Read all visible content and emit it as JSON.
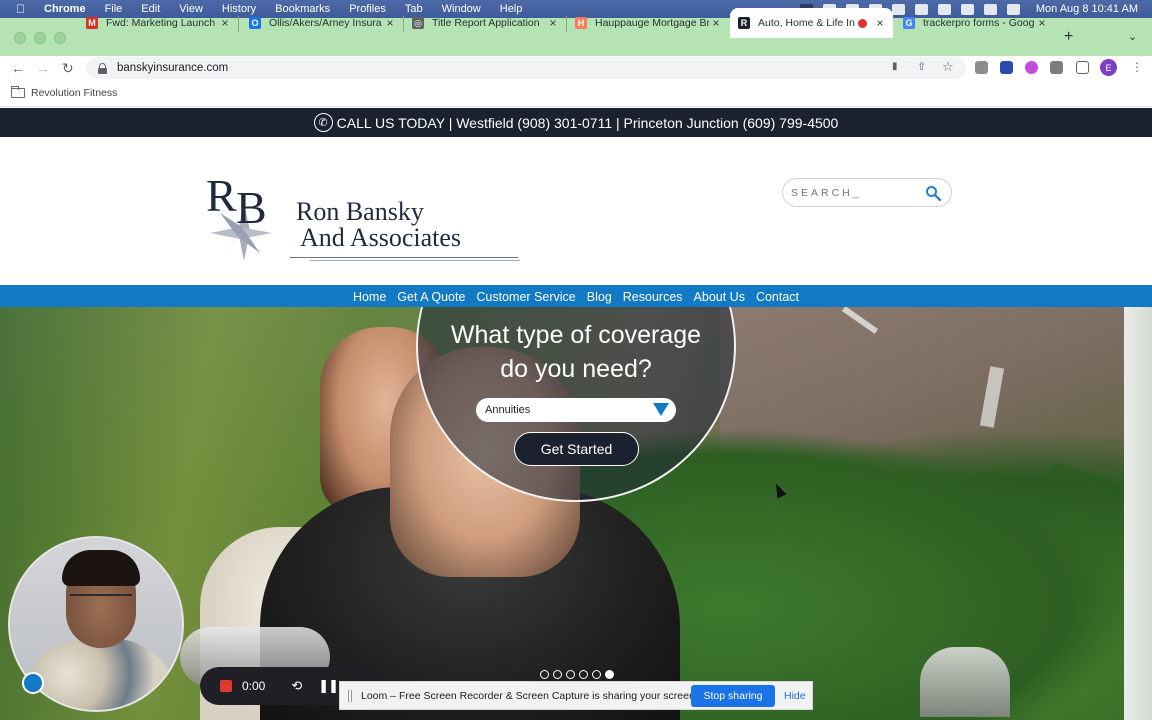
{
  "menubar": {
    "app": "Chrome",
    "items": [
      "File",
      "Edit",
      "View",
      "History",
      "Bookmarks",
      "Profiles",
      "Tab",
      "Window",
      "Help"
    ],
    "clock": "Mon Aug 8  10:41 AM"
  },
  "tabs": [
    {
      "title": "Fwd: Marketing Launch I",
      "favicon": "gmail-icon",
      "color": "#d93025",
      "glyph": "M"
    },
    {
      "title": "Ollis/Akers/Arney Insura",
      "favicon": "drive-icon",
      "color": "#1a73e8",
      "glyph": "O"
    },
    {
      "title": "Title Report Application",
      "favicon": "globe-icon",
      "color": "#5f6368",
      "glyph": "◎"
    },
    {
      "title": "Hauppauge Mortgage Br",
      "favicon": "hubspot-icon",
      "color": "#ff7a59",
      "glyph": "H"
    },
    {
      "title": "Auto, Home & Life In",
      "favicon": "rb-icon",
      "color": "#1c2130",
      "glyph": "R",
      "active": true
    },
    {
      "title": "trackerpro forms - Goog",
      "favicon": "google-icon",
      "color": "#4285f4",
      "glyph": "G"
    }
  ],
  "address": {
    "url": "banskyinsurance.com"
  },
  "bookmarks": [
    {
      "label": "Revolution Fitness"
    }
  ],
  "site": {
    "callbar": "CALL US TODAY | Westfield (908) 301-0711 | Princeton Junction (609) 799-4500",
    "logo_line1": "Ron Bansky",
    "logo_line2": "And Associates",
    "logo_mark": "RB",
    "search_placeholder": "SEARCH_",
    "nav": [
      "Home",
      "Get A Quote",
      "Customer Service",
      "Blog",
      "Resources",
      "About Us",
      "Contact"
    ],
    "coverage_line1": "What type of coverage",
    "coverage_line2": "do you need?",
    "select_value": "Annuities",
    "cta": "Get Started",
    "slide_count": 6,
    "active_slide": 6
  },
  "loom": {
    "timer": "0:00",
    "share_message": "Loom – Free Screen Recorder & Screen Capture is sharing your screen.",
    "stop_label": "Stop sharing",
    "hide_label": "Hide"
  },
  "profile_initial": "E",
  "colors": {
    "nav_blue": "#1279c4",
    "callbar": "#1c2130",
    "tabstrip": "#b6e3b4"
  }
}
